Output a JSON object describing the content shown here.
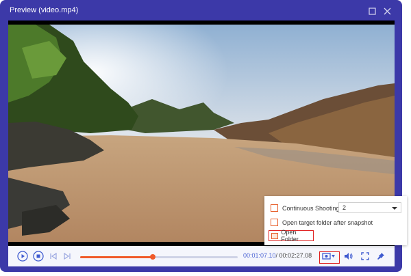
{
  "window": {
    "title": "Preview (video.mp4)"
  },
  "playback": {
    "current_time": "00:01:07.10",
    "total_time": "/ 00:02:27.08",
    "progress_fraction": 0.46
  },
  "snapshot_menu": {
    "continuous_shooting_label": "Continuous Shooting",
    "continuous_shooting_checked": false,
    "shot_count_value": "2",
    "open_after_label": "Open target folder after snapshot",
    "open_after_checked": false,
    "open_folder_label": "Open Folder"
  },
  "icons": {
    "maximize": "maximize-icon",
    "close": "close-icon",
    "play": "play-icon",
    "stop": "stop-icon",
    "previous": "skip-previous-icon",
    "next": "skip-next-icon",
    "snapshot": "camera-icon",
    "volume": "volume-icon",
    "fullscreen": "fullscreen-icon",
    "pin": "pin-icon"
  },
  "colors": {
    "frame": "#3c39a8",
    "accent": "#f05a2a",
    "highlight": "#e02020",
    "icon": "#3f5bd0"
  }
}
